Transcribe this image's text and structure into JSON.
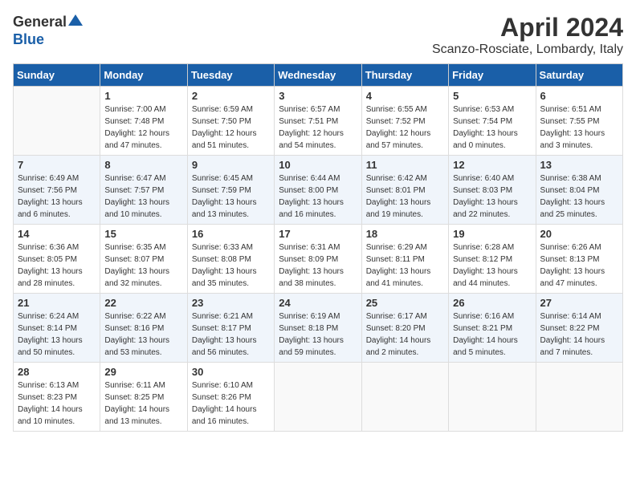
{
  "logo": {
    "general": "General",
    "blue": "Blue"
  },
  "title": "April 2024",
  "subtitle": "Scanzo-Rosciate, Lombardy, Italy",
  "days_of_week": [
    "Sunday",
    "Monday",
    "Tuesday",
    "Wednesday",
    "Thursday",
    "Friday",
    "Saturday"
  ],
  "weeks": [
    [
      {
        "day": "",
        "sunrise": "",
        "sunset": "",
        "daylight": ""
      },
      {
        "day": "1",
        "sunrise": "Sunrise: 7:00 AM",
        "sunset": "Sunset: 7:48 PM",
        "daylight": "Daylight: 12 hours and 47 minutes."
      },
      {
        "day": "2",
        "sunrise": "Sunrise: 6:59 AM",
        "sunset": "Sunset: 7:50 PM",
        "daylight": "Daylight: 12 hours and 51 minutes."
      },
      {
        "day": "3",
        "sunrise": "Sunrise: 6:57 AM",
        "sunset": "Sunset: 7:51 PM",
        "daylight": "Daylight: 12 hours and 54 minutes."
      },
      {
        "day": "4",
        "sunrise": "Sunrise: 6:55 AM",
        "sunset": "Sunset: 7:52 PM",
        "daylight": "Daylight: 12 hours and 57 minutes."
      },
      {
        "day": "5",
        "sunrise": "Sunrise: 6:53 AM",
        "sunset": "Sunset: 7:54 PM",
        "daylight": "Daylight: 13 hours and 0 minutes."
      },
      {
        "day": "6",
        "sunrise": "Sunrise: 6:51 AM",
        "sunset": "Sunset: 7:55 PM",
        "daylight": "Daylight: 13 hours and 3 minutes."
      }
    ],
    [
      {
        "day": "7",
        "sunrise": "Sunrise: 6:49 AM",
        "sunset": "Sunset: 7:56 PM",
        "daylight": "Daylight: 13 hours and 6 minutes."
      },
      {
        "day": "8",
        "sunrise": "Sunrise: 6:47 AM",
        "sunset": "Sunset: 7:57 PM",
        "daylight": "Daylight: 13 hours and 10 minutes."
      },
      {
        "day": "9",
        "sunrise": "Sunrise: 6:45 AM",
        "sunset": "Sunset: 7:59 PM",
        "daylight": "Daylight: 13 hours and 13 minutes."
      },
      {
        "day": "10",
        "sunrise": "Sunrise: 6:44 AM",
        "sunset": "Sunset: 8:00 PM",
        "daylight": "Daylight: 13 hours and 16 minutes."
      },
      {
        "day": "11",
        "sunrise": "Sunrise: 6:42 AM",
        "sunset": "Sunset: 8:01 PM",
        "daylight": "Daylight: 13 hours and 19 minutes."
      },
      {
        "day": "12",
        "sunrise": "Sunrise: 6:40 AM",
        "sunset": "Sunset: 8:03 PM",
        "daylight": "Daylight: 13 hours and 22 minutes."
      },
      {
        "day": "13",
        "sunrise": "Sunrise: 6:38 AM",
        "sunset": "Sunset: 8:04 PM",
        "daylight": "Daylight: 13 hours and 25 minutes."
      }
    ],
    [
      {
        "day": "14",
        "sunrise": "Sunrise: 6:36 AM",
        "sunset": "Sunset: 8:05 PM",
        "daylight": "Daylight: 13 hours and 28 minutes."
      },
      {
        "day": "15",
        "sunrise": "Sunrise: 6:35 AM",
        "sunset": "Sunset: 8:07 PM",
        "daylight": "Daylight: 13 hours and 32 minutes."
      },
      {
        "day": "16",
        "sunrise": "Sunrise: 6:33 AM",
        "sunset": "Sunset: 8:08 PM",
        "daylight": "Daylight: 13 hours and 35 minutes."
      },
      {
        "day": "17",
        "sunrise": "Sunrise: 6:31 AM",
        "sunset": "Sunset: 8:09 PM",
        "daylight": "Daylight: 13 hours and 38 minutes."
      },
      {
        "day": "18",
        "sunrise": "Sunrise: 6:29 AM",
        "sunset": "Sunset: 8:11 PM",
        "daylight": "Daylight: 13 hours and 41 minutes."
      },
      {
        "day": "19",
        "sunrise": "Sunrise: 6:28 AM",
        "sunset": "Sunset: 8:12 PM",
        "daylight": "Daylight: 13 hours and 44 minutes."
      },
      {
        "day": "20",
        "sunrise": "Sunrise: 6:26 AM",
        "sunset": "Sunset: 8:13 PM",
        "daylight": "Daylight: 13 hours and 47 minutes."
      }
    ],
    [
      {
        "day": "21",
        "sunrise": "Sunrise: 6:24 AM",
        "sunset": "Sunset: 8:14 PM",
        "daylight": "Daylight: 13 hours and 50 minutes."
      },
      {
        "day": "22",
        "sunrise": "Sunrise: 6:22 AM",
        "sunset": "Sunset: 8:16 PM",
        "daylight": "Daylight: 13 hours and 53 minutes."
      },
      {
        "day": "23",
        "sunrise": "Sunrise: 6:21 AM",
        "sunset": "Sunset: 8:17 PM",
        "daylight": "Daylight: 13 hours and 56 minutes."
      },
      {
        "day": "24",
        "sunrise": "Sunrise: 6:19 AM",
        "sunset": "Sunset: 8:18 PM",
        "daylight": "Daylight: 13 hours and 59 minutes."
      },
      {
        "day": "25",
        "sunrise": "Sunrise: 6:17 AM",
        "sunset": "Sunset: 8:20 PM",
        "daylight": "Daylight: 14 hours and 2 minutes."
      },
      {
        "day": "26",
        "sunrise": "Sunrise: 6:16 AM",
        "sunset": "Sunset: 8:21 PM",
        "daylight": "Daylight: 14 hours and 5 minutes."
      },
      {
        "day": "27",
        "sunrise": "Sunrise: 6:14 AM",
        "sunset": "Sunset: 8:22 PM",
        "daylight": "Daylight: 14 hours and 7 minutes."
      }
    ],
    [
      {
        "day": "28",
        "sunrise": "Sunrise: 6:13 AM",
        "sunset": "Sunset: 8:23 PM",
        "daylight": "Daylight: 14 hours and 10 minutes."
      },
      {
        "day": "29",
        "sunrise": "Sunrise: 6:11 AM",
        "sunset": "Sunset: 8:25 PM",
        "daylight": "Daylight: 14 hours and 13 minutes."
      },
      {
        "day": "30",
        "sunrise": "Sunrise: 6:10 AM",
        "sunset": "Sunset: 8:26 PM",
        "daylight": "Daylight: 14 hours and 16 minutes."
      },
      {
        "day": "",
        "sunrise": "",
        "sunset": "",
        "daylight": ""
      },
      {
        "day": "",
        "sunrise": "",
        "sunset": "",
        "daylight": ""
      },
      {
        "day": "",
        "sunrise": "",
        "sunset": "",
        "daylight": ""
      },
      {
        "day": "",
        "sunrise": "",
        "sunset": "",
        "daylight": ""
      }
    ]
  ]
}
